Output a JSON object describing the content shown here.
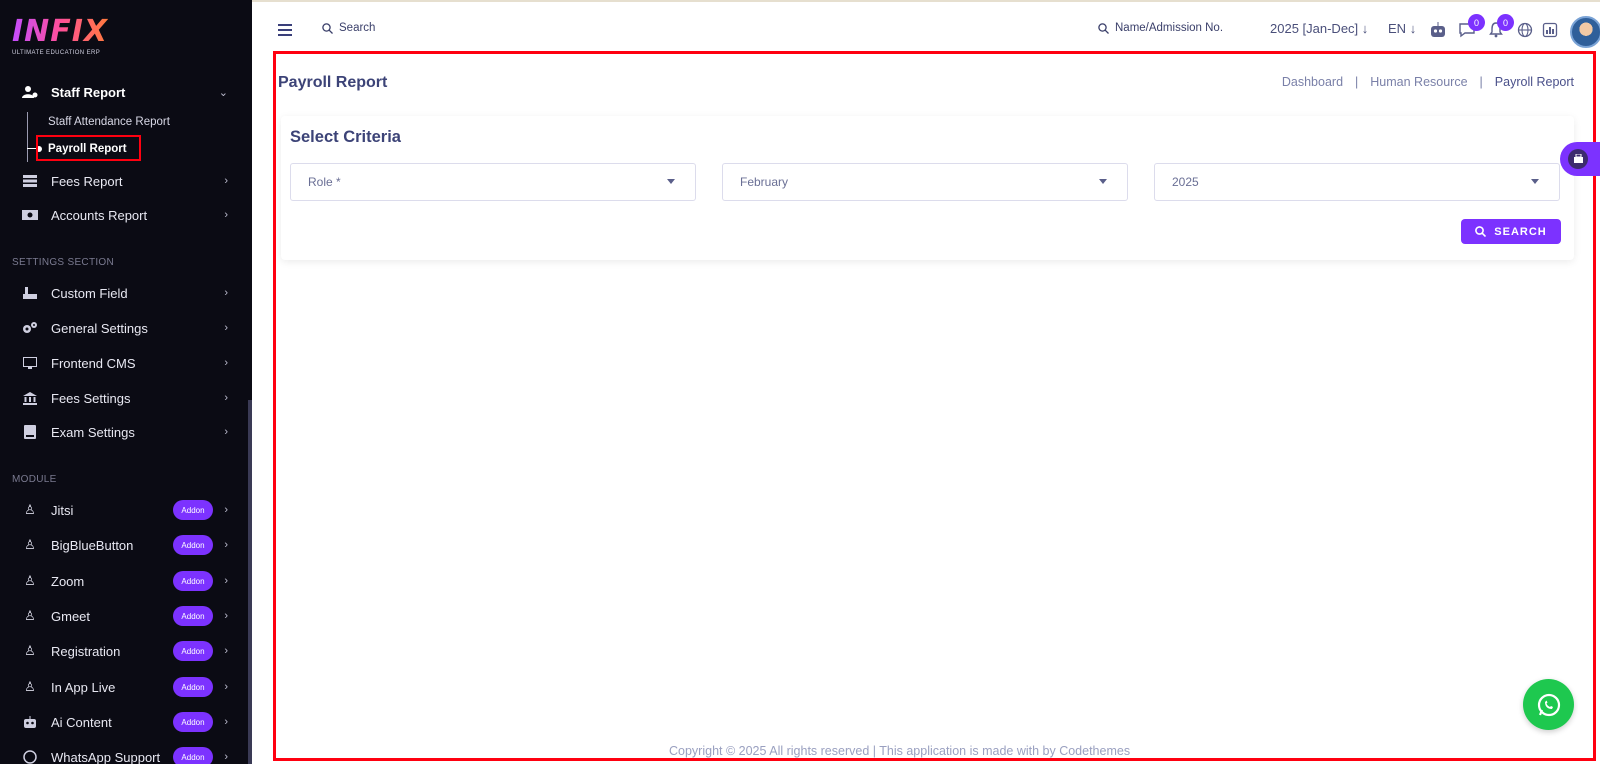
{
  "brand": {
    "logo_text": "INFIX",
    "logo_sub": "ULTIMATE EDUCATION ERP"
  },
  "sidebar": {
    "staff_report": {
      "label": "Staff Report",
      "icon": "user-cog-icon"
    },
    "sub_items": [
      {
        "label": "Staff Attendance Report"
      },
      {
        "label": "Payroll Report"
      }
    ],
    "report_items": [
      {
        "label": "Fees Report",
        "icon": "stack-icon"
      },
      {
        "label": "Accounts Report",
        "icon": "money-icon"
      }
    ],
    "settings_title": "SETTINGS SECTION",
    "settings_items": [
      {
        "label": "Custom Field",
        "icon": "custom-field-icon"
      },
      {
        "label": "General Settings",
        "icon": "gears-icon"
      },
      {
        "label": "Frontend CMS",
        "icon": "monitor-icon"
      },
      {
        "label": "Fees Settings",
        "icon": "bank-icon"
      },
      {
        "label": "Exam Settings",
        "icon": "book-icon"
      }
    ],
    "module_title": "MODULE",
    "module_items": [
      {
        "label": "Jitsi",
        "badge": "Addon",
        "icon": "person-icon"
      },
      {
        "label": "BigBlueButton",
        "badge": "Addon",
        "icon": "person-icon"
      },
      {
        "label": "Zoom",
        "badge": "Addon",
        "icon": "person-icon"
      },
      {
        "label": "Gmeet",
        "badge": "Addon",
        "icon": "person-icon"
      },
      {
        "label": "Registration",
        "badge": "Addon",
        "icon": "person-icon"
      },
      {
        "label": "In App Live",
        "badge": "Addon",
        "icon": "person-icon"
      },
      {
        "label": "Ai Content",
        "badge": "Addon",
        "icon": "robot-icon"
      },
      {
        "label": "WhatsApp Support",
        "badge": "Addon",
        "icon": "whatsapp-icon"
      }
    ]
  },
  "topbar": {
    "search_label": "Search",
    "student_search_label": "Name/Admission No.",
    "academic_year": "2025 [Jan-Dec]",
    "language": "EN",
    "chat_count": "0",
    "notification_count": "0"
  },
  "page": {
    "title": "Payroll Report",
    "breadcrumb": [
      "Dashboard",
      "Human Resource",
      "Payroll Report"
    ]
  },
  "criteria": {
    "title": "Select Criteria",
    "role_placeholder": "Role *",
    "month_value": "February",
    "year_value": "2025",
    "search_button": "SEARCH"
  },
  "footer": {
    "text": "Copyright © 2025 All rights reserved | This application is made with by Codethemes"
  },
  "colors": {
    "accent": "#7c32ff",
    "sidebar_bg": "#0b0b14",
    "highlight": "#ff0010",
    "whatsapp": "#1ec84f"
  }
}
